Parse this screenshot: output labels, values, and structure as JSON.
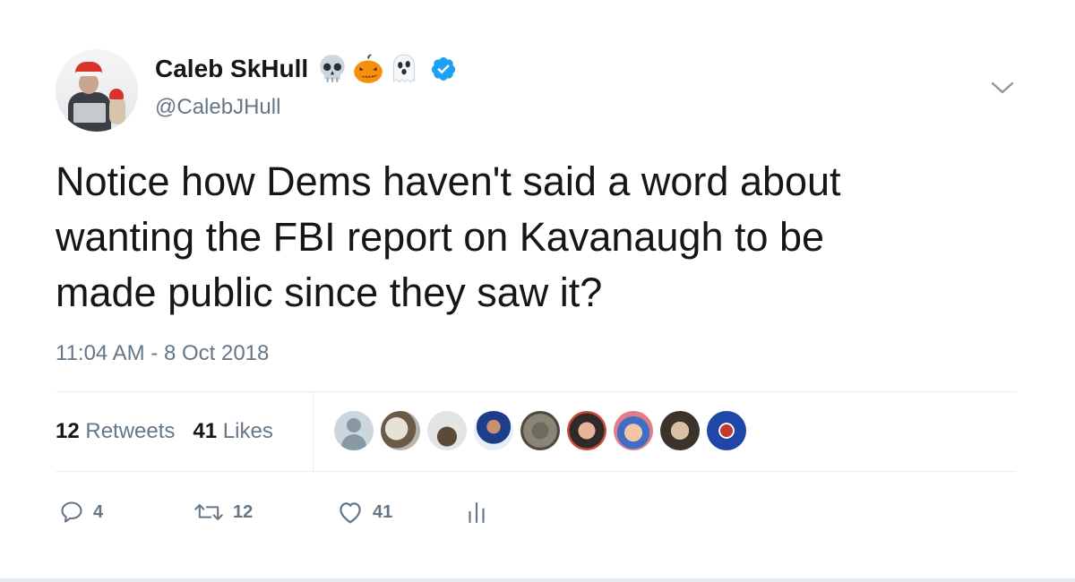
{
  "tweet": {
    "author": {
      "display_name": "Caleb SkHull",
      "name_emojis": [
        "skull-emoji",
        "jack-o-lantern-emoji",
        "ghost-emoji"
      ],
      "verified": true,
      "handle": "@CalebJHull"
    },
    "text": "Notice how Dems haven't said a word about\nwanting the FBI report on Kavanaugh to be\nmade public since they saw it?",
    "timestamp": "11:04 AM - 8 Oct 2018",
    "stats": {
      "retweets_count": "12",
      "retweets_label": "Retweets",
      "likes_count": "41",
      "likes_label": "Likes"
    },
    "actions": {
      "reply_count": "4",
      "retweet_count": "12",
      "like_count": "41"
    }
  },
  "colors": {
    "text": "#14171a",
    "secondary": "#657786",
    "divider": "#e6ecf0",
    "verified": "#1da1f2"
  }
}
